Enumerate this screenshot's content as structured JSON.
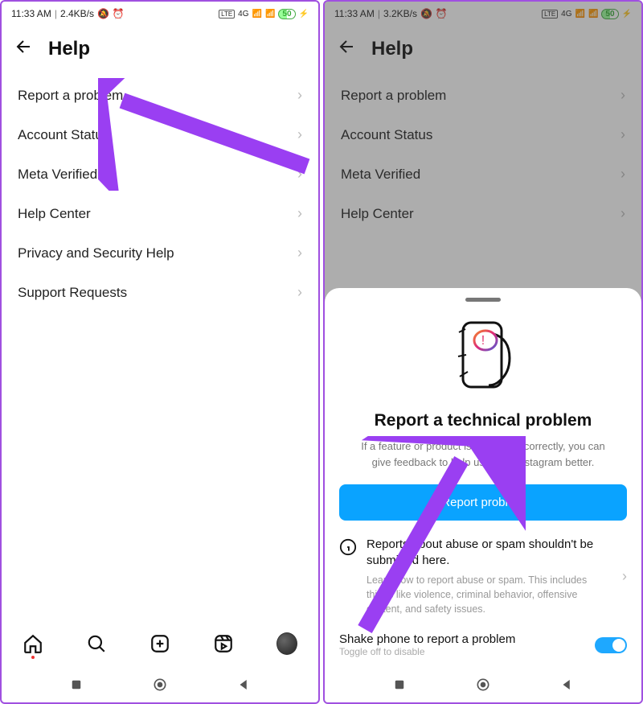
{
  "left": {
    "status": {
      "time": "11:33 AM",
      "speed": "2.4KB/s",
      "net": "4G",
      "battery": "50"
    },
    "header": {
      "title": "Help"
    },
    "menu": [
      {
        "label": "Report a problem"
      },
      {
        "label": "Account Status"
      },
      {
        "label": "Meta Verified"
      },
      {
        "label": "Help Center"
      },
      {
        "label": "Privacy and Security Help"
      },
      {
        "label": "Support Requests"
      }
    ]
  },
  "right": {
    "status": {
      "time": "11:33 AM",
      "speed": "3.2KB/s",
      "net": "4G",
      "battery": "50"
    },
    "header": {
      "title": "Help"
    },
    "menu": [
      {
        "label": "Report a problem"
      },
      {
        "label": "Account Status"
      },
      {
        "label": "Meta Verified"
      },
      {
        "label": "Help Center"
      }
    ],
    "sheet": {
      "title": "Report a technical problem",
      "subtitle": "If a feature or product isn't working correctly, you can give feedback to help us make Instagram better.",
      "primary": "Report problem",
      "abuse_title": "Reports about abuse or spam shouldn't be submitted here.",
      "abuse_desc": "Learn how to report abuse or spam. This includes things like violence, criminal behavior, offensive content, and safety issues.",
      "shake_title": "Shake phone to report a problem",
      "shake_sub": "Toggle off to disable",
      "shake_on": true
    }
  },
  "annotation": {
    "color": "#9a3ff2"
  }
}
